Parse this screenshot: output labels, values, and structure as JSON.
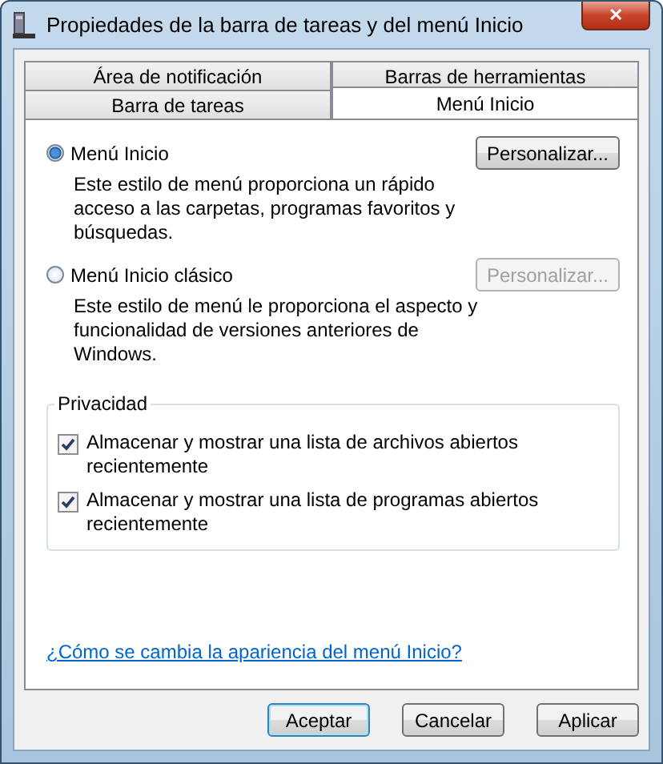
{
  "window": {
    "title": "Propiedades de la barra de tareas y del menú Inicio",
    "close": "✕"
  },
  "tab_rows": [
    [
      {
        "label": "Área de notificación",
        "selected": false
      },
      {
        "label": "Barras de herramientas",
        "selected": false
      }
    ],
    [
      {
        "label": "Barra de tareas",
        "selected": false
      },
      {
        "label": "Menú Inicio",
        "selected": true
      }
    ]
  ],
  "options": [
    {
      "label": "Menú Inicio",
      "selected": true,
      "description": "Este estilo de menú proporciona un rápido acceso a las carpetas, programas favoritos y búsquedas.",
      "button": {
        "label": "Personalizar...",
        "disabled": false
      }
    },
    {
      "label": "Menú Inicio clásico",
      "selected": false,
      "description": "Este estilo de menú le proporciona el aspecto y funcionalidad de versiones anteriores de Windows.",
      "button": {
        "label": "Personalizar...",
        "disabled": true
      }
    }
  ],
  "privacy": {
    "title": "Privacidad",
    "items": [
      {
        "label": "Almacenar y mostrar una lista de archivos abiertos recientemente",
        "checked": true
      },
      {
        "label": "Almacenar y mostrar una lista de programas abiertos recientemente",
        "checked": true
      }
    ]
  },
  "help_link": "¿Cómo se cambia la apariencia del menú Inicio?",
  "buttons": [
    {
      "label": "Aceptar",
      "default": true
    },
    {
      "label": "Cancelar",
      "default": false
    },
    {
      "label": "Aplicar",
      "default": false
    }
  ]
}
